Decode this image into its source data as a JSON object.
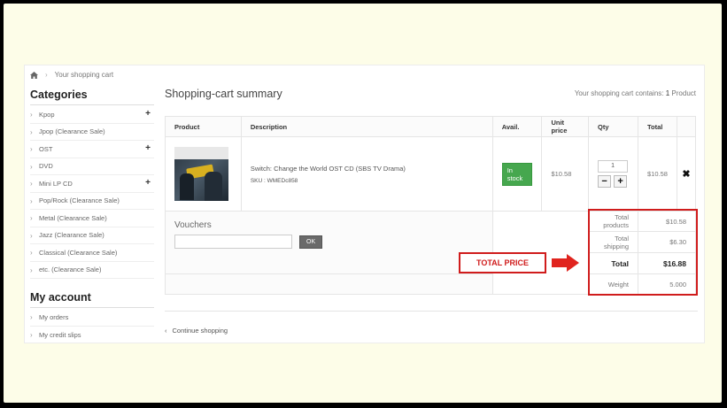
{
  "breadcrumb": {
    "home_icon": "home-icon",
    "current": "Your shopping cart"
  },
  "sidebar": {
    "categories_title": "Categories",
    "categories": [
      {
        "label": "Kpop",
        "expandable": true
      },
      {
        "label": "Jpop (Clearance Sale)",
        "expandable": false
      },
      {
        "label": "OST",
        "expandable": true
      },
      {
        "label": "DVD",
        "expandable": false
      },
      {
        "label": "Mini LP CD",
        "expandable": true
      },
      {
        "label": "Pop/Rock (Clearance Sale)",
        "expandable": false
      },
      {
        "label": "Metal (Clearance Sale)",
        "expandable": false
      },
      {
        "label": "Jazz (Clearance Sale)",
        "expandable": false
      },
      {
        "label": "Classical (Clearance Sale)",
        "expandable": false
      },
      {
        "label": "etc. (Clearance Sale)",
        "expandable": false
      }
    ],
    "account_title": "My account",
    "account_items": [
      "My orders",
      "My credit slips"
    ]
  },
  "main": {
    "title": "Shopping-cart summary",
    "cart_count_prefix": "Your shopping cart contains:",
    "cart_count_num": "1",
    "cart_count_suffix": "Product"
  },
  "table": {
    "headers": {
      "product": "Product",
      "description": "Description",
      "avail": "Avail.",
      "unit_price": "Unit price",
      "qty": "Qty",
      "total": "Total"
    },
    "item": {
      "name": "Switch: Change the World OST CD (SBS TV Drama)",
      "sku": "SKU : WMEDc858",
      "availability": "In stock",
      "unit_price": "$10.58",
      "qty": "1",
      "total": "$10.58",
      "minus": "−",
      "plus": "+",
      "delete_icon": "✖"
    },
    "vouchers": {
      "title": "Vouchers",
      "input_value": "",
      "ok_label": "OK"
    },
    "totals": {
      "products_label": "Total products",
      "products_value": "$10.58",
      "shipping_label": "Total shipping",
      "shipping_value": "$6.30",
      "total_label": "Total",
      "total_value": "$16.88",
      "weight_label": "Weight",
      "weight_value": "5.000"
    }
  },
  "annotation": {
    "label": "TOTAL PRICE",
    "color": "#d01c1c"
  },
  "footer": {
    "continue_label": "Continue shopping"
  }
}
